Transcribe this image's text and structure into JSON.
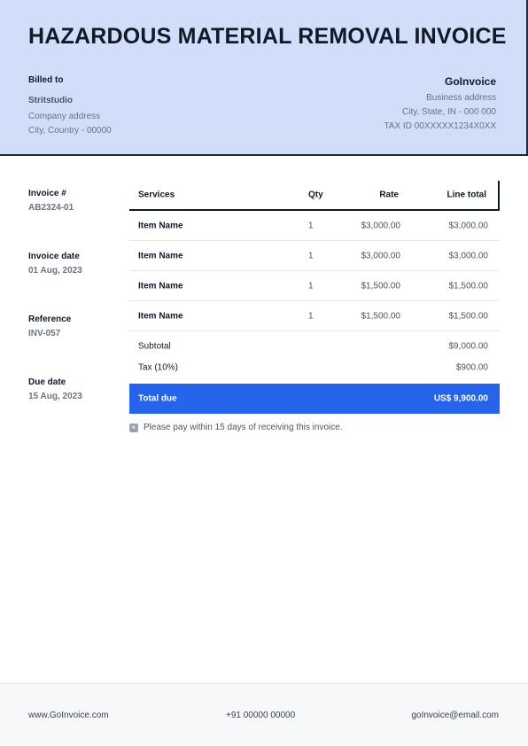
{
  "title": "HAZARDOUS MATERIAL REMOVAL INVOICE",
  "billed_to": {
    "label": "Billed to",
    "client": "Stritstudio",
    "address": "Company address",
    "city": "City, Country - 00000"
  },
  "business": {
    "name": "GoInvoice",
    "address": "Business address",
    "city": "City, State, IN - 000 000",
    "tax_id": "TAX ID 00XXXXX1234X0XX"
  },
  "meta": [
    {
      "label": "Invoice #",
      "value": "AB2324-01"
    },
    {
      "label": "Invoice date",
      "value": "01 Aug, 2023"
    },
    {
      "label": "Reference",
      "value": "INV-057"
    },
    {
      "label": "Due date",
      "value": "15 Aug, 2023"
    }
  ],
  "table": {
    "headers": {
      "service": "Services",
      "qty": "Qty",
      "rate": "Rate",
      "total": "Line total"
    },
    "rows": [
      {
        "service": "Item Name",
        "qty": "1",
        "rate": "$3,000.00",
        "total": "$3,000.00"
      },
      {
        "service": "Item Name",
        "qty": "1",
        "rate": "$3,000.00",
        "total": "$3,000.00"
      },
      {
        "service": "Item Name",
        "qty": "1",
        "rate": "$1,500.00",
        "total": "$1,500.00"
      },
      {
        "service": "Item Name",
        "qty": "1",
        "rate": "$1,500.00",
        "total": "$1,500.00"
      }
    ]
  },
  "summary": {
    "subtotal_label": "Subtotal",
    "subtotal": "$9,000.00",
    "tax_label": "Tax (10%)",
    "tax": "$900.00",
    "total_label": "Total due",
    "total": "US$ 9,900.00"
  },
  "note": {
    "icon": "note-icon",
    "text": "Please pay within 15 days of receiving this invoice."
  },
  "footer": {
    "website": "www.GoInvoice.com",
    "phone": "+91 00000 00000",
    "email": "goInvoice@email.com"
  },
  "colors": {
    "header_bg": "#d0def9",
    "accent": "#2563eb",
    "footer_bg": "#f7f8fa"
  }
}
